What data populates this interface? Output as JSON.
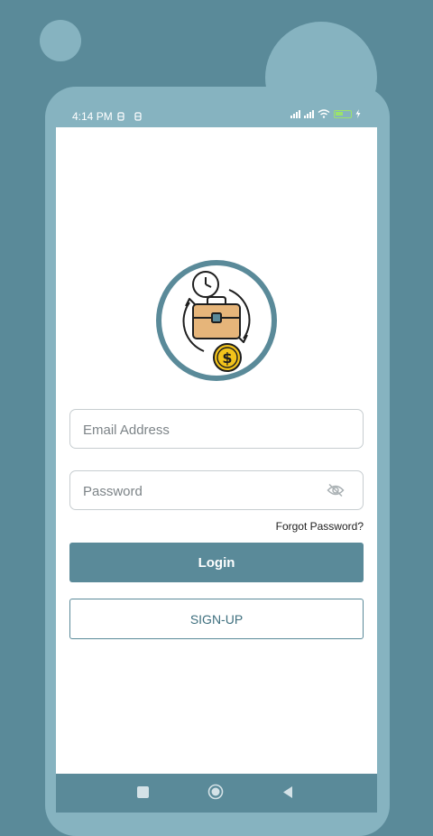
{
  "status_bar": {
    "time": "4:14 PM"
  },
  "login_form": {
    "email_placeholder": "Email Address",
    "password_placeholder": "Password",
    "forgot_password_label": "Forgot Password?",
    "login_label": "Login",
    "signup_label": "SIGN-UP"
  },
  "icons": {
    "logo": "briefcase-clock-money-icon",
    "password_toggle": "eye-off-icon",
    "nav_recent": "square-icon",
    "nav_home": "circle-icon",
    "nav_back": "triangle-back-icon"
  },
  "colors": {
    "primary": "#5a8a99",
    "phone_frame": "#86b3c0",
    "surface": "#ffffff",
    "coin": "#f2c31b",
    "briefcase": "#e6b57a"
  }
}
